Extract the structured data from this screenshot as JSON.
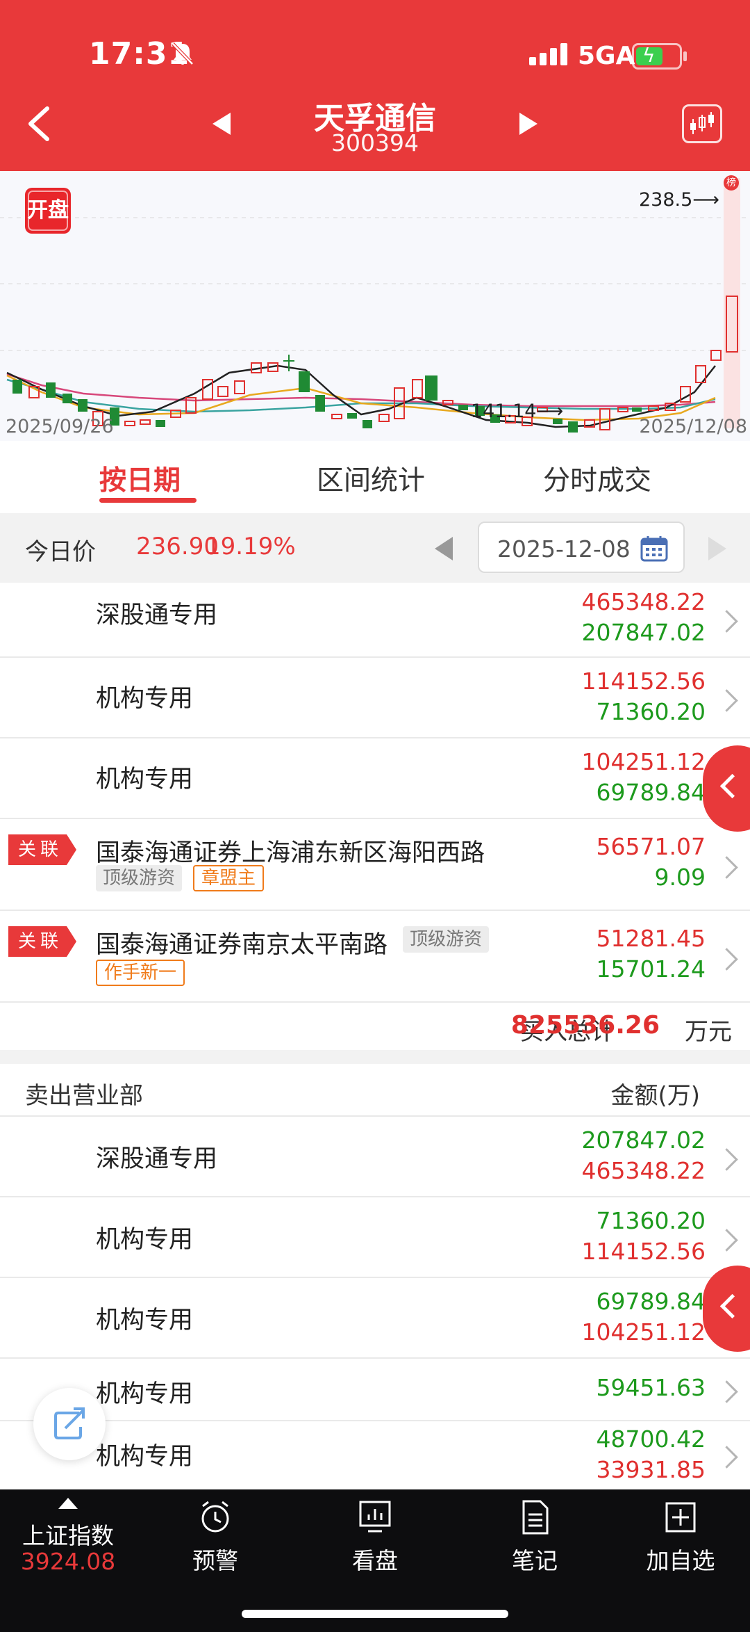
{
  "status_bar": {
    "time": "17:31",
    "network": "5GA"
  },
  "header": {
    "stock_name": "天孚通信",
    "stock_code": "300394"
  },
  "chart": {
    "badge": "开盘",
    "start_date": "2025/09/26",
    "end_date": "2025/12/08",
    "high_label": "238.5",
    "low_label": "141.14",
    "rank_tag": "榜"
  },
  "tabs": [
    "按日期",
    "区间统计",
    "分时成交"
  ],
  "price_row": {
    "label": "今日价",
    "price": "236.90",
    "change_pct": "19.19%",
    "date": "2025-12-08"
  },
  "buy_rows": [
    {
      "name": "深股通专用",
      "v1": "465348.22",
      "v2": "207847.02"
    },
    {
      "name": "机构专用",
      "v1": "114152.56",
      "v2": "71360.20"
    },
    {
      "name": "机构专用",
      "v1": "104251.12",
      "v2": "69789.84"
    },
    {
      "tag": "关联",
      "name": "国泰海通证券上海浦东新区海阳西路",
      "pill1": "顶级游资",
      "pill2": "章盟主",
      "v1": "56571.07",
      "v2": "9.09"
    },
    {
      "tag": "关联",
      "name": "国泰海通证券南京太平南路",
      "pill1": "顶级游资",
      "pill2": "作手新一",
      "v1": "51281.45",
      "v2": "15701.24"
    }
  ],
  "buy_total": {
    "label": "买入总计",
    "value": "825536.26",
    "unit": "万元"
  },
  "sell_header": {
    "title": "卖出营业部",
    "col": "金额(万)"
  },
  "sell_rows": [
    {
      "name": "深股通专用",
      "v1": "207847.02",
      "v2": "465348.22"
    },
    {
      "name": "机构专用",
      "v1": "71360.20",
      "v2": "114152.56"
    },
    {
      "name": "机构专用",
      "v1": "69789.84",
      "v2": "104251.12"
    },
    {
      "name": "机构专用",
      "v1": "59451.63"
    },
    {
      "name": "机构专用",
      "v1": "48700.42",
      "v2": "33931.85"
    }
  ],
  "bottom_nav": {
    "index_name": "上证指数",
    "index_value": "3924.08",
    "items": [
      "预警",
      "看盘",
      "笔记",
      "加自选"
    ]
  },
  "colors": {
    "brand_red": "#e8393a",
    "up_red": "#e0302f",
    "down_green": "#1d9a1d",
    "tag_orange": "#f07b1a"
  }
}
